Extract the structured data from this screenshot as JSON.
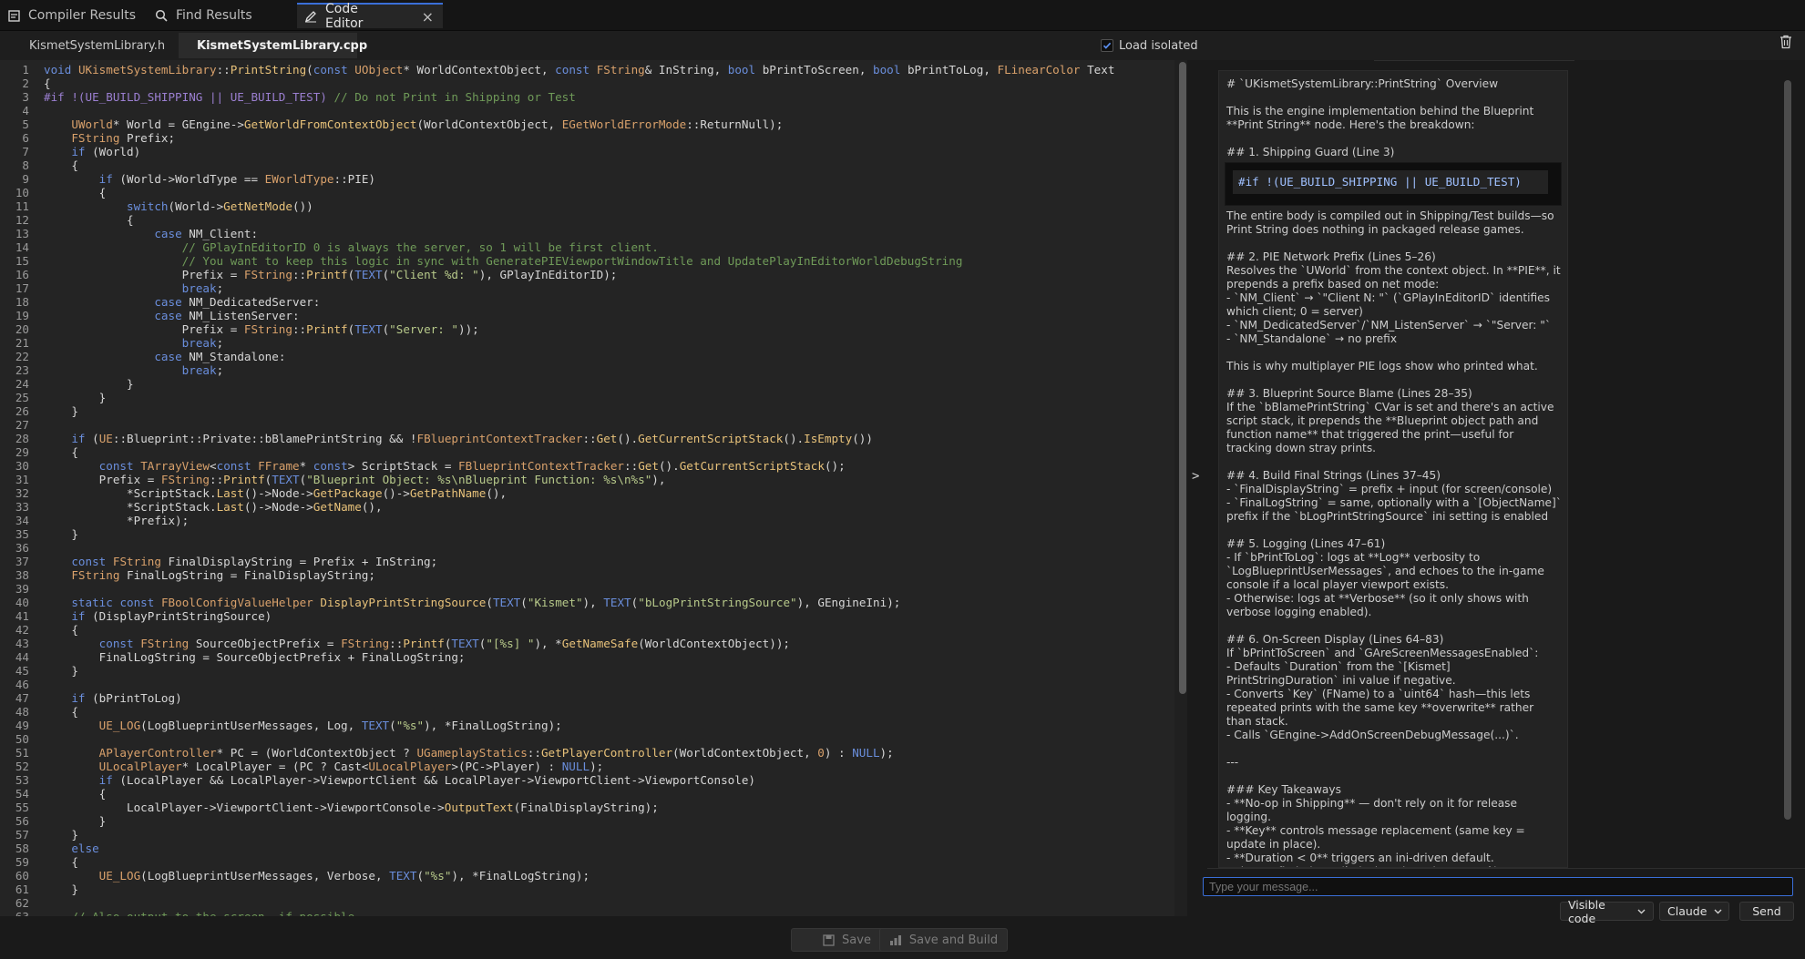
{
  "tabs": [
    {
      "label": "Compiler Results",
      "icon": "compiler-icon"
    },
    {
      "label": "Find Results",
      "icon": "search-icon"
    },
    {
      "label": "Code Editor",
      "icon": "edit-icon",
      "active": true
    }
  ],
  "file_tabs": [
    {
      "label": "KismetSystemLibrary.h"
    },
    {
      "label": "KismetSystemLibrary.cpp",
      "active": true
    }
  ],
  "load_isolated": {
    "label": "Load isolated",
    "checked": true
  },
  "code_line_numbers": [
    "1",
    "2",
    "3",
    "4",
    "5",
    "6",
    "7",
    "8",
    "9",
    "10",
    "11",
    "12",
    "13",
    "14",
    "15",
    "16",
    "17",
    "18",
    "19",
    "20",
    "21",
    "22",
    "23",
    "24",
    "25",
    "26",
    "27",
    "28",
    "29",
    "30",
    "31",
    "32",
    "33",
    "34",
    "35",
    "36",
    "37",
    "38",
    "39",
    "40",
    "41",
    "42",
    "43",
    "44",
    "45",
    "46",
    "47",
    "48",
    "49",
    "50",
    "51",
    "52",
    "53",
    "54",
    "55",
    "56",
    "57",
    "58",
    "59",
    "60",
    "61",
    "62",
    "63"
  ],
  "code_lines": [
    "void UKismetSystemLibrary::PrintString(const UObject* WorldContextObject, const FString& InString, bool bPrintToScreen, bool bPrintToLog, FLinearColor Text",
    "{",
    "#if !(UE_BUILD_SHIPPING || UE_BUILD_TEST) // Do not Print in Shipping or Test",
    "",
    "    UWorld* World = GEngine->GetWorldFromContextObject(WorldContextObject, EGetWorldErrorMode::ReturnNull);",
    "    FString Prefix;",
    "    if (World)",
    "    {",
    "        if (World->WorldType == EWorldType::PIE)",
    "        {",
    "            switch(World->GetNetMode())",
    "            {",
    "                case NM_Client:",
    "                    // GPlayInEditorID 0 is always the server, so 1 will be first client.",
    "                    // You want to keep this logic in sync with GeneratePIEViewportWindowTitle and UpdatePlayInEditorWorldDebugString",
    "                    Prefix = FString::Printf(TEXT(\"Client %d: \"), GPlayInEditorID);",
    "                    break;",
    "                case NM_DedicatedServer:",
    "                case NM_ListenServer:",
    "                    Prefix = FString::Printf(TEXT(\"Server: \"));",
    "                    break;",
    "                case NM_Standalone:",
    "                    break;",
    "            }",
    "        }",
    "    }",
    "",
    "    if (UE::Blueprint::Private::bBlamePrintString && !FBlueprintContextTracker::Get().GetCurrentScriptStack().IsEmpty())",
    "    {",
    "        const TArrayView<const FFrame* const> ScriptStack = FBlueprintContextTracker::Get().GetCurrentScriptStack();",
    "        Prefix = FString::Printf(TEXT(\"Blueprint Object: %s\\nBlueprint Function: %s\\n%s\"),",
    "            *ScriptStack.Last()->Node->GetPackage()->GetPathName(),",
    "            *ScriptStack.Last()->Node->GetName(),",
    "            *Prefix);",
    "    }",
    "",
    "    const FString FinalDisplayString = Prefix + InString;",
    "    FString FinalLogString = FinalDisplayString;",
    "",
    "    static const FBoolConfigValueHelper DisplayPrintStringSource(TEXT(\"Kismet\"), TEXT(\"bLogPrintStringSource\"), GEngineIni);",
    "    if (DisplayPrintStringSource)",
    "    {",
    "        const FString SourceObjectPrefix = FString::Printf(TEXT(\"[%s] \"), *GetNameSafe(WorldContextObject));",
    "        FinalLogString = SourceObjectPrefix + FinalLogString;",
    "    }",
    "",
    "    if (bPrintToLog)",
    "    {",
    "        UE_LOG(LogBlueprintUserMessages, Log, TEXT(\"%s\"), *FinalLogString);",
    "",
    "        APlayerController* PC = (WorldContextObject ? UGameplayStatics::GetPlayerController(WorldContextObject, 0) : NULL);",
    "        ULocalPlayer* LocalPlayer = (PC ? Cast<ULocalPlayer>(PC->Player) : NULL);",
    "        if (LocalPlayer && LocalPlayer->ViewportClient && LocalPlayer->ViewportClient->ViewportConsole)",
    "        {",
    "            LocalPlayer->ViewportClient->ViewportConsole->OutputText(FinalDisplayString);",
    "        }",
    "    }",
    "    else",
    "    {",
    "        UE_LOG(LogBlueprintUserMessages, Verbose, TEXT(\"%s\"), *FinalLogString);",
    "    }",
    "",
    "    // Also output to the screen, if possible"
  ],
  "chat": {
    "messages": [
      "# `UKismetSystemLibrary::PrintString` Overview",
      "",
      "This is the engine implementation behind the Blueprint **Print String** node. Here's the breakdown:",
      "",
      "## 1. Shipping Guard (Line 3)",
      "#CODE#",
      "The entire body is compiled out in Shipping/Test builds—so Print String does nothing in packaged release games.",
      "",
      "## 2. PIE Network Prefix (Lines 5–26)",
      "Resolves the `UWorld` from the context object. In **PIE**, it prepends a prefix based on net mode:",
      "- `NM_Client` → `\"Client N: \"` (`GPlayInEditorID` identifies which client; 0 = server)",
      "- `NM_DedicatedServer`/`NM_ListenServer` → `\"Server: \"`",
      "- `NM_Standalone` → no prefix",
      "",
      "This is why multiplayer PIE logs show who printed what.",
      "",
      "## 3. Blueprint Source Blame (Lines 28–35)",
      "If the `bBlamePrintString` CVar is set and there's an active script stack, it prepends the **Blueprint object path and function name** that triggered the print—useful for tracking down stray prints.",
      "",
      "## 4. Build Final Strings (Lines 37–45)",
      "- `FinalDisplayString` = prefix + input (for screen/console)",
      "- `FinalLogString` = same, optionally with a `[ObjectName]` prefix if the `bLogPrintStringSource` ini setting is enabled",
      "",
      "## 5. Logging (Lines 47–61)",
      "- If `bPrintToLog`: logs at **Log** verbosity to `LogBlueprintUserMessages`, and echoes to the in-game console if a local player viewport exists.",
      "- Otherwise: logs at **Verbose** (so it only shows with verbose logging enabled).",
      "",
      "## 6. On-Screen Display (Lines 64–83)",
      "If `bPrintToScreen` and `GAreScreenMessagesEnabled`:",
      "- Defaults `Duration` from the `[Kismet] PrintStringDuration` ini value if negative.",
      "- Converts `Key` (FName) to a `uint64` hash—this lets repeated prints with the same key **overwrite** rather than stack.",
      "- Calls `GEngine->AddOnScreenDebugMessage(...)`.",
      "",
      "---",
      "",
      "### Key Takeaways",
      "- **No-op in Shipping** — don't rely on it for release logging.",
      "- **Key** controls message replacement (same key = update in place).",
      "- **Duration < 0** triggers an ini-driven default.",
      "- The config helpers (`DisplayPrintStringSource`) are `static`, so the ini is read once."
    ],
    "code_block": "#if !(UE_BUILD_SHIPPING || UE_BUILD_TEST)",
    "input_placeholder": "Type your message...",
    "visibility_option": "Visible code",
    "model_option": "Claude",
    "send_label": "Send"
  },
  "splitter_glyph": ">",
  "footer": {
    "save_label": "Save",
    "save_build_label": "Save and Build"
  },
  "colors": {
    "accent": "#3a6fd8",
    "editor_bg": "#242424",
    "keyword": "#6a8edc",
    "type": "#d9a16b",
    "function": "#e8c27a",
    "string": "#b7c98a",
    "comment": "#6f9a58"
  }
}
